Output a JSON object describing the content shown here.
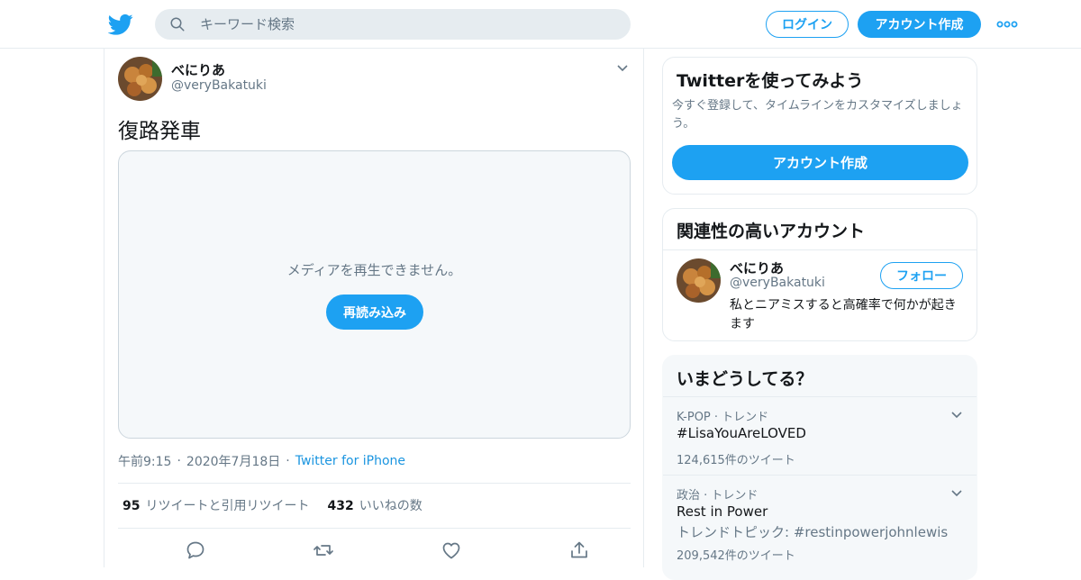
{
  "header": {
    "logo_icon": "twitter-bird-icon",
    "search_placeholder": "キーワード検索",
    "login_label": "ログイン",
    "signup_label": "アカウント作成",
    "more_icon": "more-dots-icon",
    "brand_color": "#1da1f2"
  },
  "tweet": {
    "author_name": "べにりあ",
    "author_handle": "@veryBakatuki",
    "text": "復路発車",
    "media": {
      "message": "メディアを再生できません。",
      "reload_label": "再読み込み"
    },
    "time": "午前9:15",
    "date": "2020年7月18日",
    "source": "Twitter for iPhone",
    "retweet_count": "95",
    "retweet_label": "リツイートと引用リツイート",
    "like_count": "432",
    "like_label": "いいねの数"
  },
  "sidebar": {
    "signup_card": {
      "title": "Twitterを使ってみよう",
      "description": "今すぐ登録して、タイムラインをカスタマイズしましょう。",
      "button_label": "アカウント作成"
    },
    "relevant": {
      "title": "関連性の高いアカウント",
      "account": {
        "name": "べにりあ",
        "handle": "@veryBakatuki",
        "follow_label": "フォロー",
        "bio": "私とニアミスすると高確率で何かが起きます"
      }
    },
    "trends": {
      "title": "いまどうしてる？",
      "items": [
        {
          "context": "K-POP · トレンド",
          "name": "#LisaYouAreLOVED",
          "count": "124,615件のツイート"
        },
        {
          "context": "政治 · トレンド",
          "name": "Rest in Power",
          "description": "トレンドトピック: #restinpowerjohnlewis",
          "count": "209,542件のツイート"
        }
      ]
    }
  }
}
